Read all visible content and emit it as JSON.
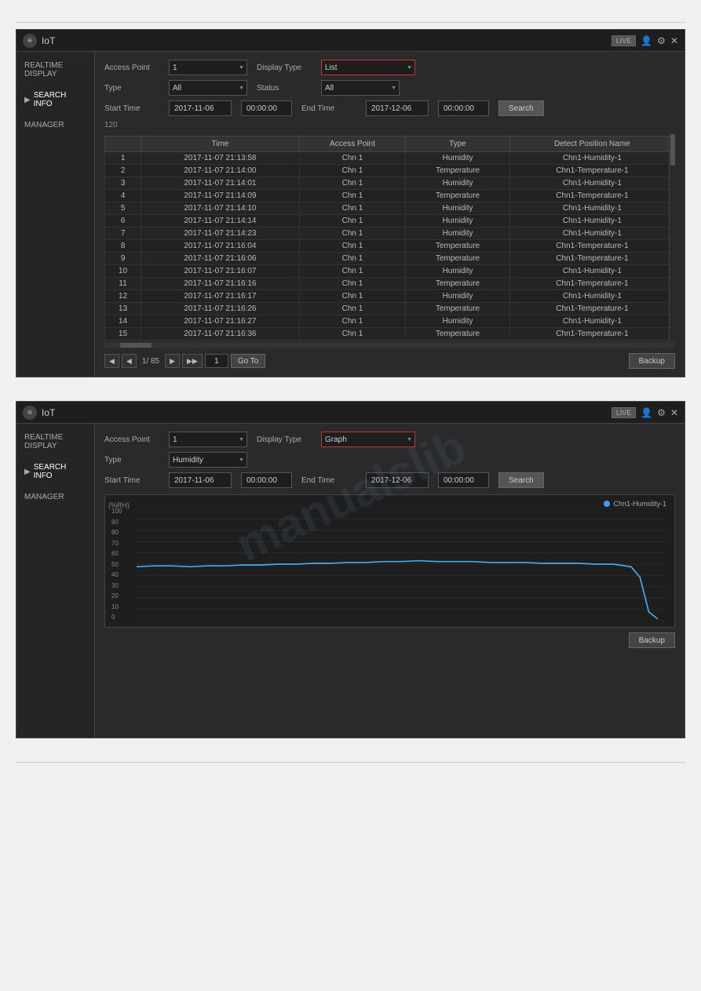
{
  "page": {
    "background_color": "#f0f0f0"
  },
  "panel1": {
    "title": "IoT",
    "live_badge": "LIVE",
    "sidebar": {
      "items": [
        {
          "label": "REALTIME DISPLAY",
          "active": false
        },
        {
          "label": "SEARCH INFO",
          "active": true,
          "arrow": true
        },
        {
          "label": "MANAGER",
          "active": false
        }
      ]
    },
    "form": {
      "access_point_label": "Access Point",
      "access_point_value": "1",
      "display_type_label": "Display Type",
      "display_type_value": "List",
      "type_label": "Type",
      "type_value": "All",
      "status_label": "Status",
      "status_value": "All",
      "start_time_label": "Start Time",
      "start_time_date": "2017-11-06",
      "start_time_time": "00:00:00",
      "end_time_label": "End Time",
      "end_time_date": "2017-12-06",
      "end_time_time": "00:00:00",
      "search_btn": "Search"
    },
    "table": {
      "record_count": "120",
      "columns": [
        "",
        "Time",
        "Access Point",
        "Type",
        "Detect Position Name"
      ],
      "rows": [
        {
          "num": "1",
          "time": "2017-11-07 21:13:58",
          "access_point": "Chn 1",
          "type": "Humidity",
          "position": "Chn1-Humidity-1"
        },
        {
          "num": "2",
          "time": "2017-11-07 21:14:00",
          "access_point": "Chn 1",
          "type": "Temperature",
          "position": "Chn1-Temperature-1"
        },
        {
          "num": "3",
          "time": "2017-11-07 21:14:01",
          "access_point": "Chn 1",
          "type": "Humidity",
          "position": "Chn1-Humidity-1"
        },
        {
          "num": "4",
          "time": "2017-11-07 21:14:09",
          "access_point": "Chn 1",
          "type": "Temperature",
          "position": "Chn1-Temperature-1"
        },
        {
          "num": "5",
          "time": "2017-11-07 21:14:10",
          "access_point": "Chn 1",
          "type": "Humidity",
          "position": "Chn1-Humidity-1"
        },
        {
          "num": "6",
          "time": "2017-11-07 21:14:14",
          "access_point": "Chn 1",
          "type": "Humidity",
          "position": "Chn1-Humidity-1"
        },
        {
          "num": "7",
          "time": "2017-11-07 21:14:23",
          "access_point": "Chn 1",
          "type": "Humidity",
          "position": "Chn1-Humidity-1"
        },
        {
          "num": "8",
          "time": "2017-11-07 21:16:04",
          "access_point": "Chn 1",
          "type": "Temperature",
          "position": "Chn1-Temperature-1"
        },
        {
          "num": "9",
          "time": "2017-11-07 21:16:06",
          "access_point": "Chn 1",
          "type": "Temperature",
          "position": "Chn1-Temperature-1"
        },
        {
          "num": "10",
          "time": "2017-11-07 21:16:07",
          "access_point": "Chn 1",
          "type": "Humidity",
          "position": "Chn1-Humidity-1"
        },
        {
          "num": "11",
          "time": "2017-11-07 21:16:16",
          "access_point": "Chn 1",
          "type": "Temperature",
          "position": "Chn1-Temperature-1"
        },
        {
          "num": "12",
          "time": "2017-11-07 21:16:17",
          "access_point": "Chn 1",
          "type": "Humidity",
          "position": "Chn1-Humidity-1"
        },
        {
          "num": "13",
          "time": "2017-11-07 21:16:26",
          "access_point": "Chn 1",
          "type": "Temperature",
          "position": "Chn1-Temperature-1"
        },
        {
          "num": "14",
          "time": "2017-11-07 21:16:27",
          "access_point": "Chn 1",
          "type": "Humidity",
          "position": "Chn1-Humidity-1"
        },
        {
          "num": "15",
          "time": "2017-11-07 21:16:36",
          "access_point": "Chn 1",
          "type": "Temperature",
          "position": "Chn1-Temperature-1"
        }
      ]
    },
    "pagination": {
      "prev_prev": "◀◀",
      "prev": "◀",
      "next": "▶",
      "next_next": "▶▶",
      "page_info": "1/ 85",
      "goto_value": "1",
      "goto_label": "Go To",
      "backup_label": "Backup"
    }
  },
  "panel2": {
    "title": "IoT",
    "live_badge": "LIVE",
    "sidebar": {
      "items": [
        {
          "label": "REALTIME DISPLAY",
          "active": false
        },
        {
          "label": "SEARCH INFO",
          "active": true,
          "arrow": true
        },
        {
          "label": "MANAGER",
          "active": false
        }
      ]
    },
    "form": {
      "access_point_label": "Access Point",
      "access_point_value": "1",
      "display_type_label": "Display Type",
      "display_type_value": "Graph",
      "type_label": "Type",
      "type_value": "Humidity",
      "start_time_label": "Start Time",
      "start_time_date": "2017-11-06",
      "start_time_time": "00:00:00",
      "end_time_label": "End Time",
      "end_time_date": "2017-12-06",
      "end_time_time": "00:00:00",
      "search_btn": "Search"
    },
    "graph": {
      "y_axis_label": "(%RH)",
      "y_values": [
        "100",
        "90",
        "80",
        "70",
        "60",
        "50",
        "40",
        "30",
        "20",
        "10",
        "0"
      ],
      "legend_label": "Chn1-Humidity-1",
      "backup_label": "Backup"
    }
  }
}
